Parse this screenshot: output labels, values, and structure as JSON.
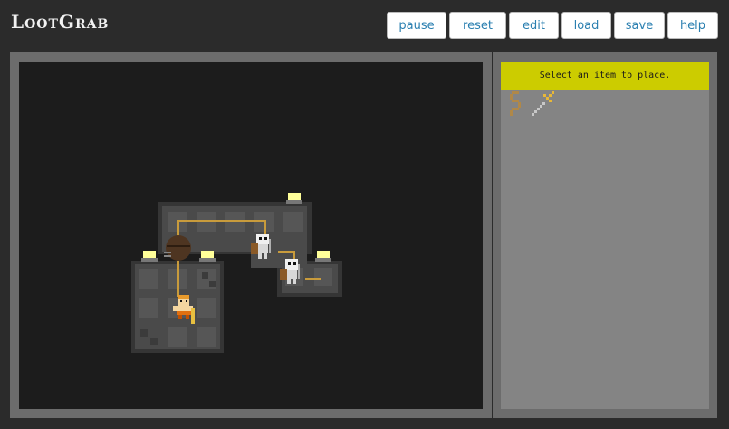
{
  "app": {
    "title": "LootGrab"
  },
  "toolbar": {
    "buttons": [
      {
        "id": "pause",
        "label": "pause"
      },
      {
        "id": "reset",
        "label": "reset"
      },
      {
        "id": "edit",
        "label": "edit"
      },
      {
        "id": "load",
        "label": "load"
      },
      {
        "id": "save",
        "label": "save"
      },
      {
        "id": "help",
        "label": "help"
      }
    ]
  },
  "side_panel": {
    "hint": "Select an item to place.",
    "items": [
      {
        "name": "rope-icon"
      },
      {
        "name": "sword-icon"
      }
    ]
  },
  "colors": {
    "hint_bg": "#cccc00",
    "button_text": "#2a7fb0",
    "board_bg": "#1c1c1c",
    "floor": "#4a4a4a",
    "wire": "#c89b3c",
    "lamp": "#ffff99"
  }
}
